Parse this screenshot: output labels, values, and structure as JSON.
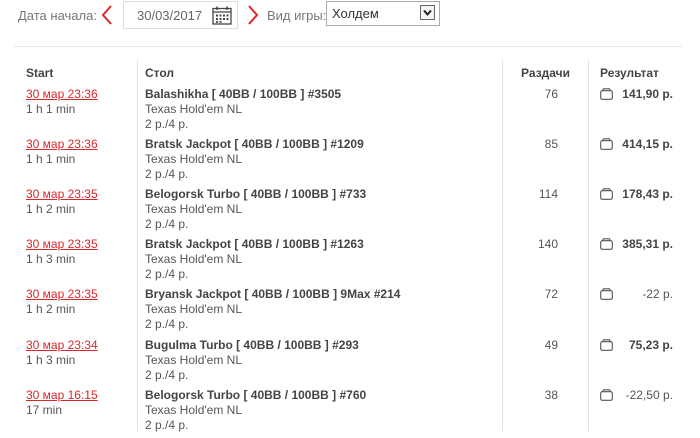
{
  "filters": {
    "date_label": "Дата начала:",
    "date_value": "30/03/2017",
    "game_label": "Вид игры:",
    "game_value": "Холдем"
  },
  "table": {
    "headers": {
      "start": "Start",
      "table": "Стол",
      "hands": "Раздачи",
      "result": "Результат"
    },
    "rows": [
      {
        "start": "30 мар 23:36",
        "duration": "1 h 1 min",
        "name": "Balashikha [ 40BB / 100BB ] #3505",
        "game": "Texas Hold'em NL",
        "buyin": "2 р./4 р.",
        "hands": "76",
        "result": "141,90 р.",
        "positive": true
      },
      {
        "start": "30 мар 23:36",
        "duration": "1 h 1 min",
        "name": "Bratsk Jackpot [ 40BB / 100BB ] #1209",
        "game": "Texas Hold'em NL",
        "buyin": "2 р./4 р.",
        "hands": "85",
        "result": "414,15 р.",
        "positive": true
      },
      {
        "start": "30 мар 23:35",
        "duration": "1 h 2 min",
        "name": "Belogorsk Turbo [ 40BB / 100BB ] #733",
        "game": "Texas Hold'em NL",
        "buyin": "2 р./4 р.",
        "hands": "114",
        "result": "178,43 р.",
        "positive": true
      },
      {
        "start": "30 мар 23:35",
        "duration": "1 h 3 min",
        "name": "Bratsk Jackpot [ 40BB / 100BB ] #1263",
        "game": "Texas Hold'em NL",
        "buyin": "2 р./4 р.",
        "hands": "140",
        "result": "385,31 р.",
        "positive": true
      },
      {
        "start": "30 мар 23:35",
        "duration": "1 h 2 min",
        "name": "Bryansk Jackpot [ 40BB / 100BB ] 9Max #214",
        "game": "Texas Hold'em NL",
        "buyin": "2 р./4 р.",
        "hands": "72",
        "result": "-22 р.",
        "positive": false
      },
      {
        "start": "30 мар 23:34",
        "duration": "1 h 3 min",
        "name": "Bugulma Turbo [ 40BB / 100BB ] #293",
        "game": "Texas Hold'em NL",
        "buyin": "2 р./4 р.",
        "hands": "49",
        "result": "75,23 р.",
        "positive": true
      },
      {
        "start": "30 мар 16:15",
        "duration": "17 min",
        "name": "Belogorsk Turbo [ 40BB / 100BB ] #760",
        "game": "Texas Hold'em NL",
        "buyin": "2 р./4 р.",
        "hands": "38",
        "result": "-22,50 р.",
        "positive": false
      }
    ]
  },
  "icons": {
    "prev": "chevron-left-icon",
    "next": "chevron-right-icon",
    "calendar": "calendar-icon",
    "dropdown": "chevron-down-icon",
    "result": "wallet-icon"
  },
  "colors": {
    "accent": "#d9282c",
    "text": "#444444"
  }
}
